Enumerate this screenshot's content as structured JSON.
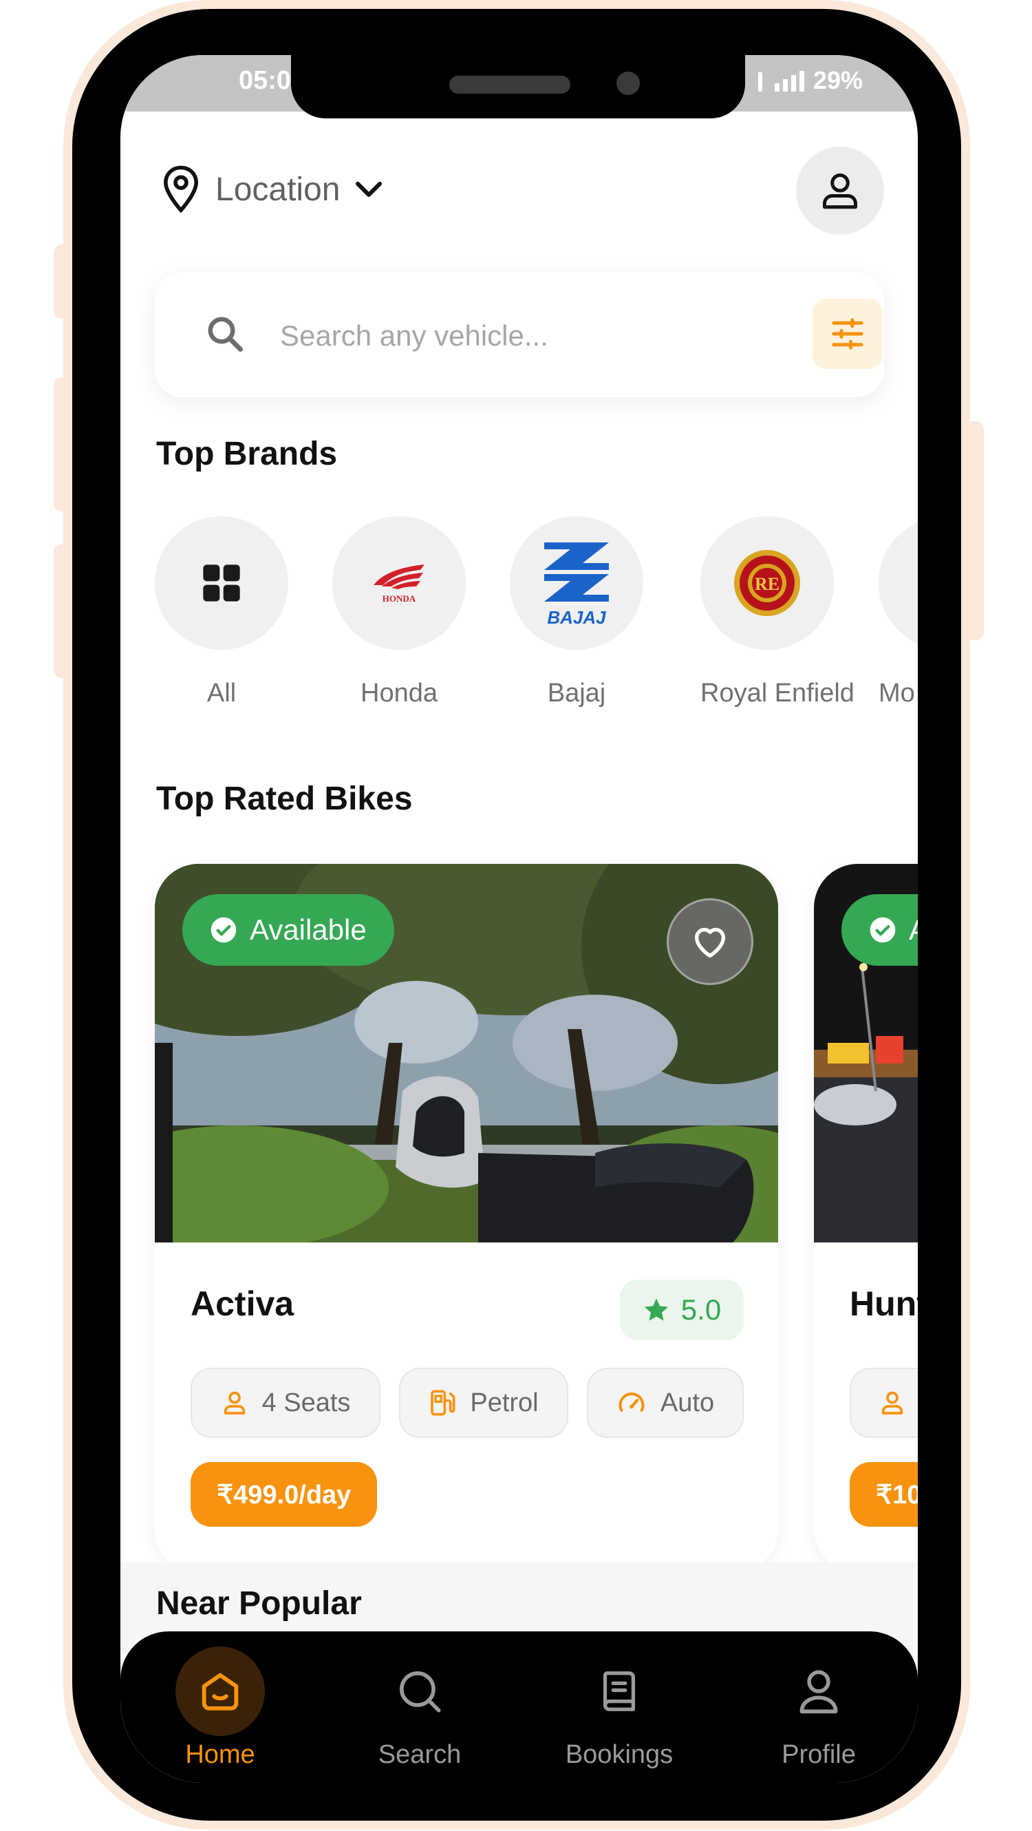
{
  "status_bar": {
    "time": "05:0",
    "battery": "29%"
  },
  "header": {
    "location_label": "Location"
  },
  "search": {
    "placeholder": "Search any vehicle..."
  },
  "sections": {
    "top_brands": "Top Brands",
    "top_rated": "Top Rated Bikes",
    "near_popular": "Near Popular"
  },
  "brands": [
    {
      "name": "All",
      "icon": "grid-icon"
    },
    {
      "name": "Honda",
      "logo_text": "HONDA",
      "icon": "honda-logo"
    },
    {
      "name": "Bajaj",
      "logo_text": "BAJAJ",
      "icon": "bajaj-logo"
    },
    {
      "name": "Royal Enfield",
      "logo_text": "RE",
      "icon": "royal-enfield-logo"
    },
    {
      "name": "Mo",
      "icon": "brand-logo"
    }
  ],
  "bikes": [
    {
      "name": "Activa",
      "status": "Available",
      "rating": "5.0",
      "seats": "4 Seats",
      "fuel": "Petrol",
      "transmission": "Auto",
      "price": "₹499.0/day"
    },
    {
      "name": "Hunt",
      "status": "A",
      "price": "₹10"
    }
  ],
  "nav": [
    {
      "label": "Home",
      "icon": "home-icon",
      "active": true
    },
    {
      "label": "Search",
      "icon": "search-icon",
      "active": false
    },
    {
      "label": "Bookings",
      "icon": "bookings-icon",
      "active": false
    },
    {
      "label": "Profile",
      "icon": "profile-icon",
      "active": false
    }
  ],
  "colors": {
    "accent": "#f7930f",
    "available": "#35a853",
    "frame": "#fae8da"
  }
}
